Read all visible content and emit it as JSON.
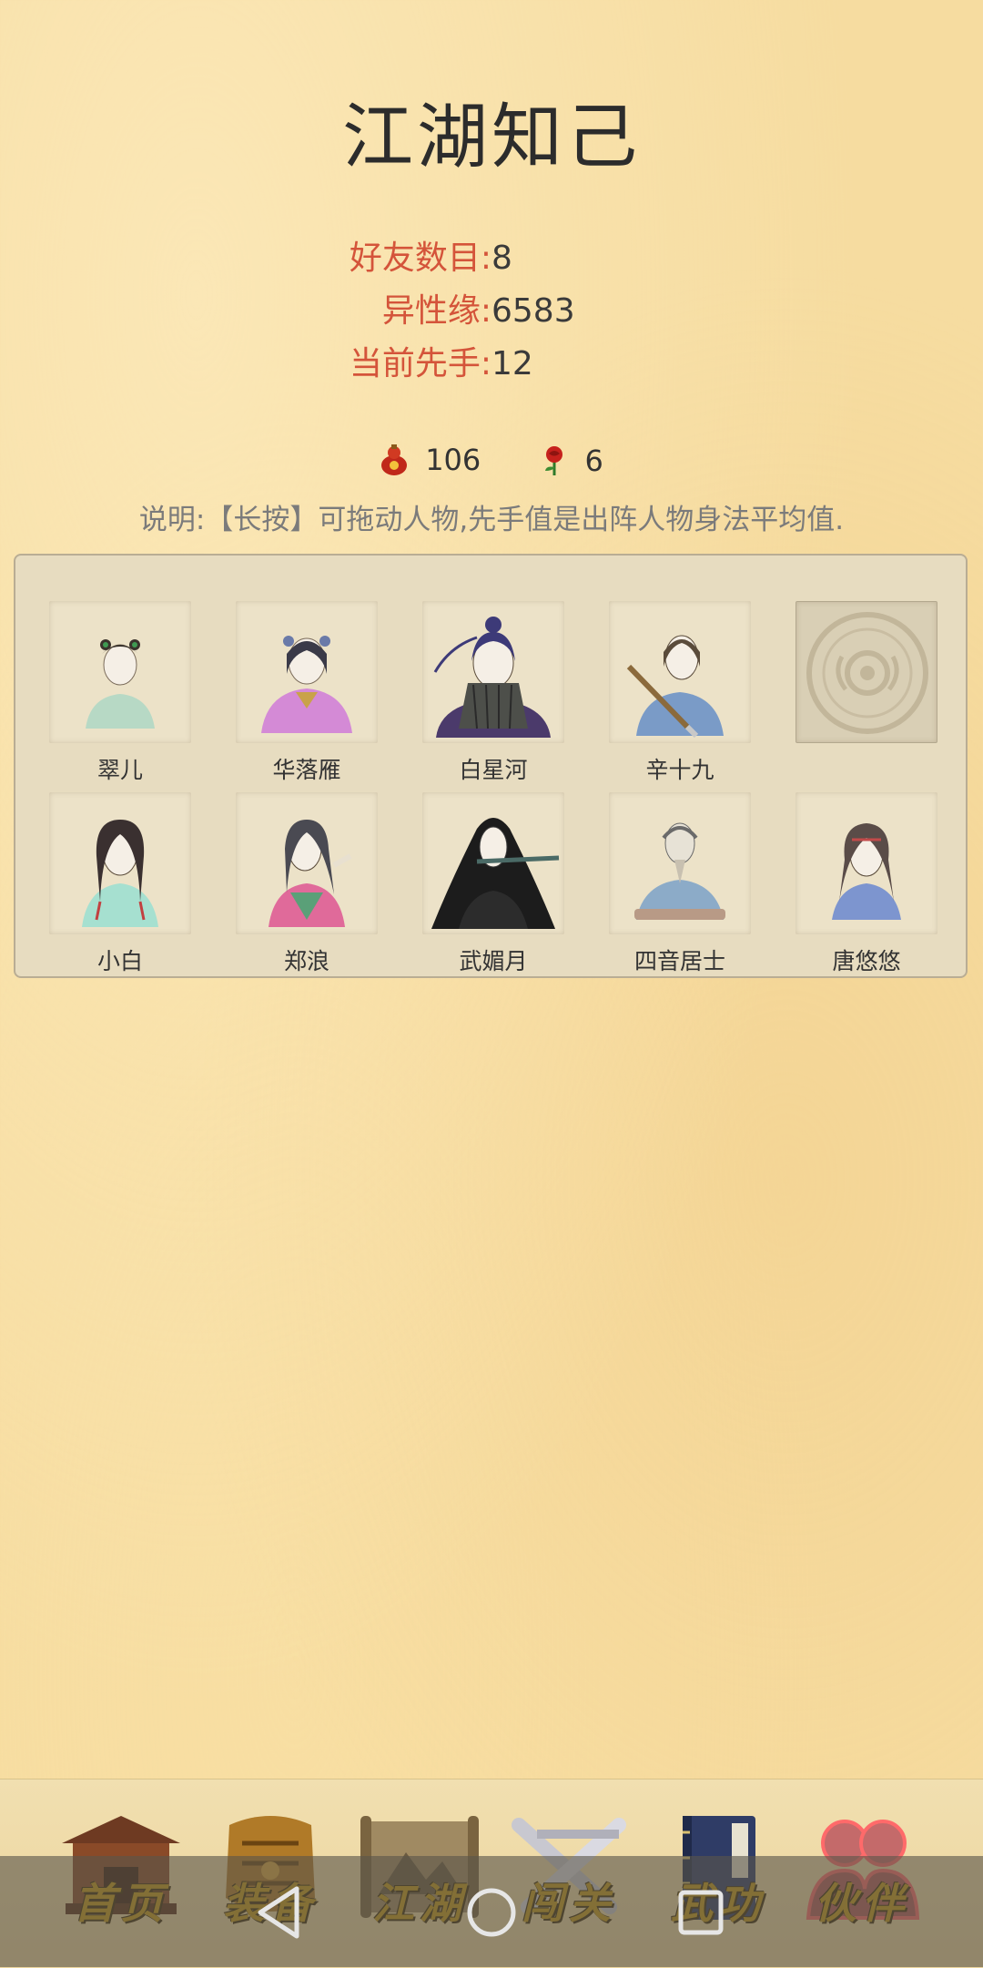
{
  "page": {
    "title": "江湖知己"
  },
  "stats": [
    {
      "label": "好友数目:",
      "value": "8"
    },
    {
      "label": "异性缘:",
      "value": "6583"
    },
    {
      "label": "当前先手:",
      "value": "12"
    }
  ],
  "currency": {
    "gourd": {
      "icon": "red-gourd-icon",
      "value": "106"
    },
    "rose": {
      "icon": "rose-icon",
      "value": "6"
    }
  },
  "note": "说明:【长按】可拖动人物,先手值是出阵人物身法平均值.",
  "characters": [
    {
      "name": "翠儿"
    },
    {
      "name": "华落雁"
    },
    {
      "name": "白星河"
    },
    {
      "name": "辛十九"
    },
    {
      "name": ""
    },
    {
      "name": "小白"
    },
    {
      "name": "郑浪"
    },
    {
      "name": "武媚月"
    },
    {
      "name": "四音居士"
    },
    {
      "name": "唐悠悠"
    }
  ],
  "nav": [
    {
      "label": "首页",
      "icon": "palace-icon"
    },
    {
      "label": "装备",
      "icon": "armor-icon"
    },
    {
      "label": "江湖",
      "icon": "scroll-map-icon"
    },
    {
      "label": "闯关",
      "icon": "crossed-swords-icon"
    },
    {
      "label": "武功",
      "icon": "martial-book-icon"
    },
    {
      "label": "伙伴",
      "icon": "companions-icon",
      "active": true
    }
  ],
  "colors": {
    "background": "#f6dca0",
    "stat_label": "#d4543a",
    "nav_label": "#c49a16",
    "note": "#7b7b7b"
  }
}
